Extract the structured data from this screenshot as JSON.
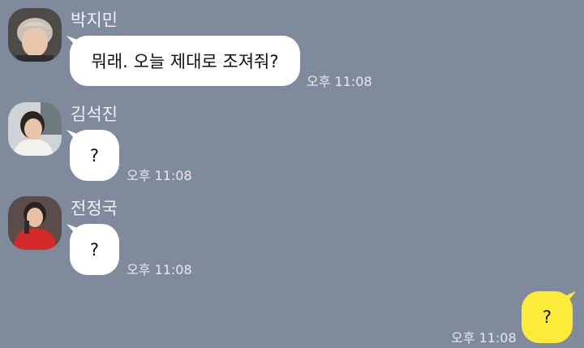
{
  "messages": [
    {
      "sender": "박지민",
      "text": "뭐래. 오늘 제대로 조져줘?",
      "time": "오후 11:08",
      "avatar": "jimin-avatar"
    },
    {
      "sender": "김석진",
      "text": "?",
      "time": "오후 11:08",
      "avatar": "seokjin-avatar"
    },
    {
      "sender": "전정국",
      "text": "?",
      "time": "오후 11:08",
      "avatar": "jungkook-avatar"
    },
    {
      "sender": "me",
      "text": "?",
      "time": "오후 11:08"
    }
  ],
  "colors": {
    "background": "#7f8a9d",
    "incoming_bubble": "#ffffff",
    "outgoing_bubble": "#fdeb3a",
    "name_text": "#eef1f6",
    "time_text": "#e6e9ee"
  }
}
